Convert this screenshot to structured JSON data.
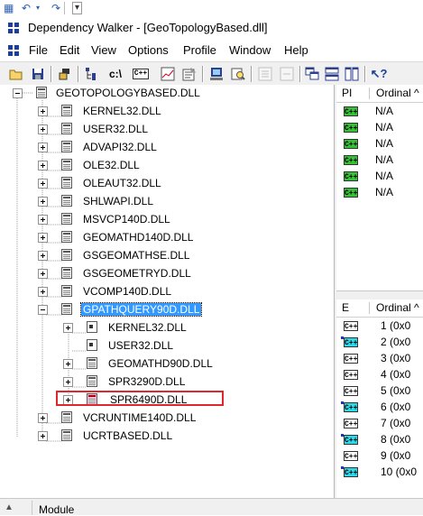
{
  "quick_access": {
    "undo_icon": "undo-icon",
    "redo_icon": "redo-icon"
  },
  "window": {
    "title": "Dependency Walker - [GeoTopologyBased.dll]"
  },
  "menu": [
    "File",
    "Edit",
    "View",
    "Options",
    "Profile",
    "Window",
    "Help"
  ],
  "toolbar": {
    "icons": [
      "open-icon",
      "save-icon",
      "copy-icon",
      "tree-icon",
      "path-icon",
      "cpp-icon",
      "graph-icon",
      "properties-icon",
      "system-info-icon",
      "find-icon",
      "expand-icon",
      "collapse-icon",
      "cascade-icon",
      "tile-horizontal-icon",
      "tile-vertical-icon",
      "help-icon"
    ],
    "path_label": "c:\\",
    "cpp_label": "C++"
  },
  "tree": {
    "root": "GEOTOPOLOGYBASED.DLL",
    "children": [
      "KERNEL32.DLL",
      "USER32.DLL",
      "ADVAPI32.DLL",
      "OLE32.DLL",
      "OLEAUT32.DLL",
      "SHLWAPI.DLL",
      "MSVCP140D.DLL",
      "GEOMATHD140D.DLL",
      "GSGEOMATHSE.DLL",
      "GSGEOMETRYD.DLL",
      "VCOMP140D.DLL"
    ],
    "selected": "GPATHQUERY90D.DLL",
    "selected_children": [
      "KERNEL32.DLL",
      "USER32.DLL",
      "GEOMATHD90D.DLL",
      "SPR3290D.DLL",
      "SPR6490D.DLL"
    ],
    "after": [
      "VCRUNTIME140D.DLL",
      "UCRTBASED.DLL"
    ]
  },
  "import_pane": {
    "col_pi": "PI",
    "col_ordinal": "Ordinal ^",
    "rows": [
      "N/A",
      "N/A",
      "N/A",
      "N/A",
      "N/A",
      "N/A"
    ]
  },
  "export_pane": {
    "col_e": "E",
    "col_ordinal": "Ordinal ^",
    "rows": [
      "1 (0x0",
      "2 (0x0",
      "3 (0x0",
      "4 (0x0",
      "5 (0x0",
      "6 (0x0",
      "7 (0x0",
      "8 (0x0",
      "9 (0x0",
      "10 (0x0"
    ]
  },
  "module_pane": {
    "label": "Module"
  },
  "cpp_badge": "C++"
}
